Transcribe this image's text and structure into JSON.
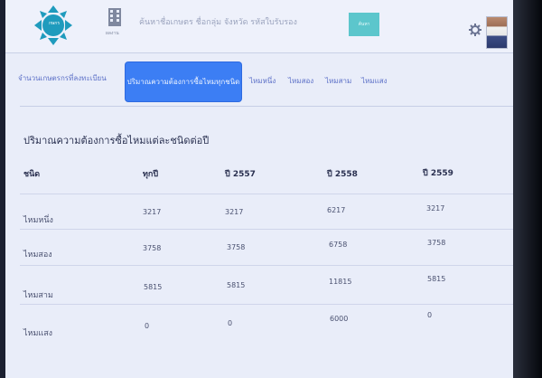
{
  "app": {
    "logo_text": "กษกร",
    "building_label": "ผลงาน",
    "search_placeholder": "ค้นหาชื่อเกษตร ชื่อกลุ่ม จังหวัด รหัสใบรับรอง",
    "search_button": "ค้นหา"
  },
  "tabs": [
    {
      "label": "จำนวนเกษตรกรที่ลงทะเบียน"
    },
    {
      "label": "ปริมาณความต้องการซื้อไหมทุกชนิด"
    },
    {
      "label": "ไหมหนึ่ง"
    },
    {
      "label": "ไหมสอง"
    },
    {
      "label": "ไหมสาม"
    },
    {
      "label": "ไหมแสง"
    }
  ],
  "section_title": "ปริมาณความต้องการซื้อไหมแต่ละชนิดต่อปี",
  "table": {
    "headers": [
      "ชนิด",
      "ทุกปี",
      "ปี 2557",
      "ปี 2558",
      "ปี 2559"
    ],
    "rows": [
      [
        "ไหมหนึ่ง",
        "3217",
        "3217",
        "6217",
        "3217"
      ],
      [
        "ไหมสอง",
        "3758",
        "3758",
        "6758",
        "3758"
      ],
      [
        "ไหมสาม",
        "5815",
        "5815",
        "11815",
        "5815"
      ],
      [
        "ไหมแสง",
        "0",
        "0",
        "6000",
        "0"
      ]
    ]
  },
  "colors": {
    "active_tab": "#3c7ef4",
    "search_button": "#5cc6cc",
    "logo": "#1f9bbd"
  }
}
